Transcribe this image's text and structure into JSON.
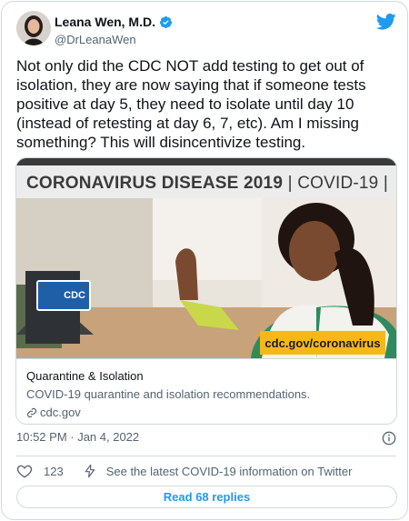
{
  "author": {
    "name": "Leana Wen, M.D.",
    "handle": "@DrLeanaWen",
    "verified": true
  },
  "tweet": {
    "text": "Not only did the CDC NOT add testing to get out of isolation, they are now saying that if someone tests positive at day 5, they need to isolate until day 10 (instead of retesting at day 6, 7, etc). Am I missing something? This will disincentivize testing."
  },
  "link_card": {
    "banner_bold": "CORONAVIRUS DISEASE 2019",
    "banner_rest": "COVID-19",
    "logo_text": "CDC",
    "url_tag": "cdc.gov/coronavirus",
    "title": "Quarantine & Isolation",
    "description": "COVID-19 quarantine and isolation recommendations.",
    "domain": "cdc.gov"
  },
  "meta": {
    "timestamp": "10:52 PM · Jan 4, 2022"
  },
  "actions": {
    "like_count": "123",
    "covid_link": "See the latest COVID-19 information on Twitter"
  },
  "replies_button": "Read 68 replies",
  "colors": {
    "accent": "#1d9bf0",
    "text": "#0f1419",
    "secondary": "#536471",
    "border": "#cfd9de",
    "cdc_blue": "#1e5fa8",
    "url_tag_yellow": "#f6b819"
  },
  "icons": [
    "verified-badge-icon",
    "twitter-bird-icon",
    "link-icon",
    "info-icon",
    "heart-icon",
    "bolt-icon"
  ]
}
